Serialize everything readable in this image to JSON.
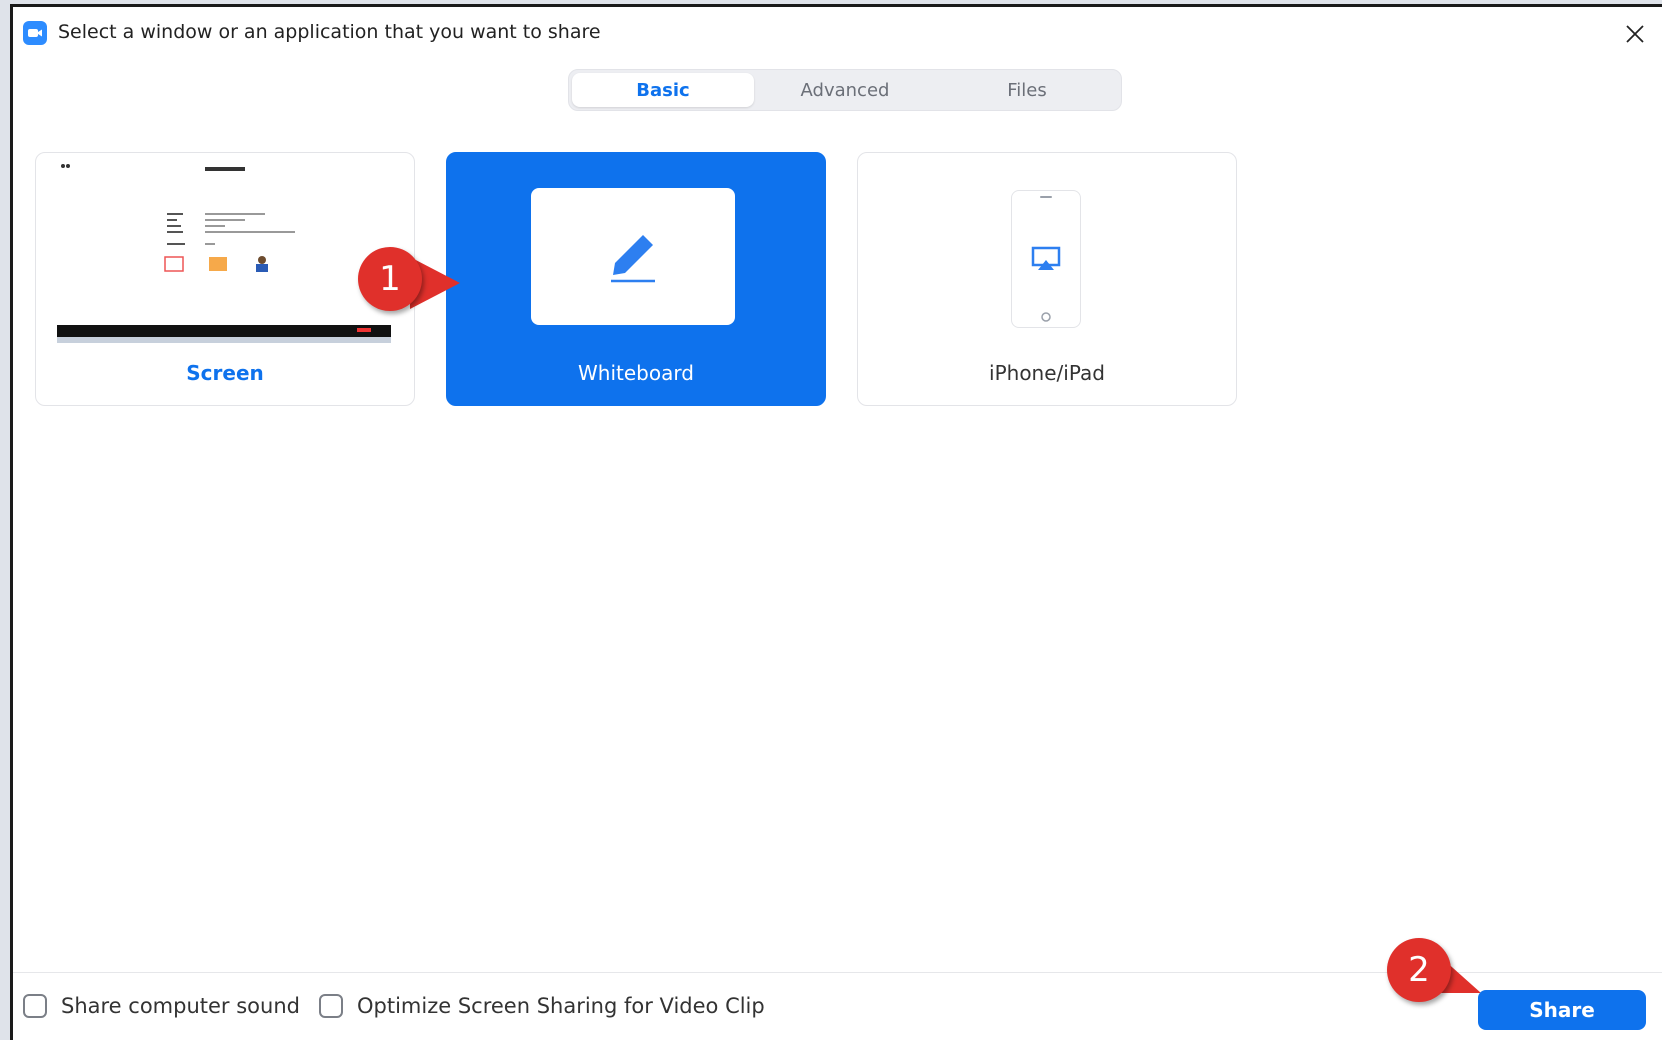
{
  "window": {
    "title": "Select a window or an application that you want to share"
  },
  "tabs": [
    {
      "label": "Basic",
      "active": true
    },
    {
      "label": "Advanced",
      "active": false
    },
    {
      "label": "Files",
      "active": false
    }
  ],
  "share_options": [
    {
      "label": "Screen",
      "selected": false
    },
    {
      "label": "Whiteboard",
      "selected": true
    },
    {
      "label": "iPhone/iPad",
      "selected": false
    }
  ],
  "annotations": {
    "step1": "1",
    "step2": "2"
  },
  "footer": {
    "sound_label": "Share computer sound",
    "optimize_label": "Optimize Screen Sharing for Video Clip",
    "share_label": "Share"
  },
  "colors": {
    "accent": "#0e72ed",
    "callout": "#e0302b"
  }
}
